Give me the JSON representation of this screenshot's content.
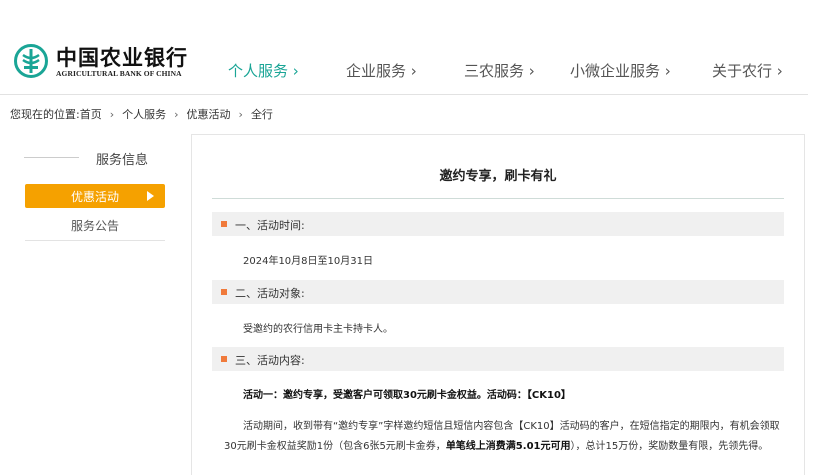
{
  "brand": {
    "name_cn": "中国农业银行",
    "name_en": "AGRICULTURAL BANK OF CHINA",
    "colors": {
      "teal": "#1aa596",
      "orange": "#f5a100",
      "bullet": "#f07a3b"
    }
  },
  "nav": {
    "items": [
      {
        "label": "个人服务 ›",
        "active": true
      },
      {
        "label": "企业服务 ›",
        "active": false
      },
      {
        "label": "三农服务 ›",
        "active": false
      },
      {
        "label": "小微企业服务 ›",
        "active": false
      },
      {
        "label": "关于农行 ›",
        "active": false
      }
    ]
  },
  "breadcrumb": {
    "prefix": "您现在的位置:",
    "items": [
      "首页",
      "个人服务",
      "优惠活动",
      "全行"
    ],
    "separator": "›"
  },
  "sidebar": {
    "title": "服务信息",
    "items": [
      {
        "label": "优惠活动",
        "active": true,
        "icon": "triangle-right-icon"
      },
      {
        "label": "服务公告",
        "active": false
      }
    ]
  },
  "article": {
    "title": "邀约专享，刷卡有礼",
    "sections": [
      {
        "label": "一、活动时间:",
        "body": "2024年10月8日至10月31日"
      },
      {
        "label": "二、活动对象:",
        "body": "受邀约的农行信用卡主卡持卡人。"
      },
      {
        "label": "三、活动内容:"
      }
    ],
    "activity1": {
      "heading": "活动一：邀约专享，受邀客户可领取30元刷卡金权益。活动码：【CK10】",
      "line1": "活动期间，收到带有“邀约专享”字样邀约短信且短信内容包含【CK10】活动码的客户，在短信指定的期限内，有机会领取",
      "line2_a": "30元刷卡金权益奖励1份（包含6张5元刷卡金券，",
      "line2_b": "单笔线上消费满5.01元可用",
      "line2_c": "），总计15万份，奖励数量有限，先领先得。"
    }
  }
}
